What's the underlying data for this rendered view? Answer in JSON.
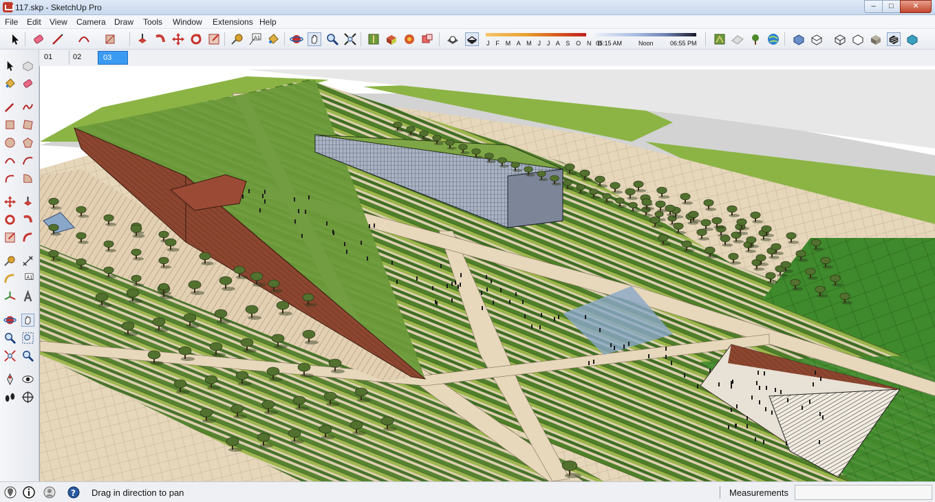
{
  "window": {
    "title": "117.skp - SketchUp Pro",
    "minimize": "–",
    "maximize": "□",
    "close": "✕"
  },
  "menu": [
    "File",
    "Edit",
    "View",
    "Camera",
    "Draw",
    "Tools",
    "Window",
    "Extensions",
    "Help"
  ],
  "toolbar": {
    "icons": [
      "select-icon",
      "eraser-icon",
      "line-icon",
      "arc-icon",
      "rectangle-icon",
      "push-pull-icon",
      "follow-me-icon",
      "move-icon",
      "rotate-icon",
      "scale-icon",
      "tape-measure-icon",
      "text-icon",
      "paint-bucket-icon",
      "orbit-icon",
      "pan-icon",
      "zoom-icon",
      "zoom-extents-icon",
      "add-location-icon",
      "get-models-icon",
      "share-model-icon",
      "components-icon",
      "x-ray-icon",
      "back-edges-icon",
      "wireframe-icon",
      "hidden-line-icon",
      "shaded-icon",
      "shaded-textures-icon",
      "monochrome-icon"
    ],
    "shadow_months": "J F M A M J J A S O N D",
    "time_start": "05:15 AM",
    "time_noon": "Noon",
    "time_end": "06:55 PM"
  },
  "scenes": {
    "tabs": [
      "01",
      "02",
      "03"
    ],
    "active_index": 2
  },
  "status": {
    "hint": "Drag in direction to pan",
    "measurements_label": "Measurements",
    "measurements_value": ""
  },
  "colors": {
    "accent": "#3b9af2",
    "grass_dark": "#4e7a2a",
    "grass_light": "#8fb04a",
    "paving": "#e2cfb0",
    "brick": "#8c3f2c",
    "glass": "#8d97a8"
  }
}
